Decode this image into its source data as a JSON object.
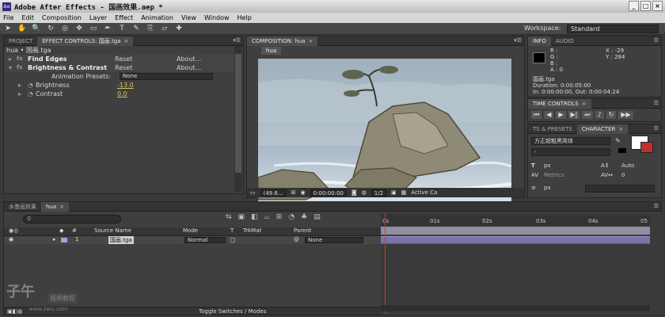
{
  "window": {
    "app_icon": "Ae",
    "title": "Adobe After Effects - 国画效果.aep *",
    "buttons": [
      "_",
      "□",
      "×"
    ]
  },
  "menu": [
    "File",
    "Edit",
    "Composition",
    "Layer",
    "Effect",
    "Animation",
    "View",
    "Window",
    "Help"
  ],
  "toolbar": {
    "tools": [
      "hand-pointer-icon",
      "hand-icon",
      "zoom-icon",
      "rotate-icon",
      "orbit-icon",
      "pan-icon",
      "rect-mask-icon",
      "pen-icon",
      "text-icon",
      "brush-icon",
      "clone-icon",
      "eraser-icon",
      "puppet-icon"
    ],
    "tool_glyphs": [
      "➤",
      "✋",
      "🔍",
      "↻",
      "◎",
      "✥",
      "▭",
      "✒",
      "T",
      "✎",
      "⎘",
      "▱",
      "✚"
    ],
    "workspace_label": "Workspace:",
    "workspace_value": "Standard"
  },
  "project_panel": {
    "tabs": [
      "PROJECT",
      "EFFECT CONTROLS: 国画.tga"
    ],
    "header": "hua • 国画.tga",
    "effects": [
      {
        "name": "Find Edges",
        "reset": "Reset",
        "about": "About..."
      },
      {
        "name": "Brightness & Contrast",
        "reset": "Reset",
        "about": "About..."
      }
    ],
    "animation_presets_label": "Animation Presets:",
    "animation_presets_value": "None",
    "params": [
      {
        "name": "Brightness",
        "value": "-13.0"
      },
      {
        "name": "Contrast",
        "value": "0.0"
      }
    ]
  },
  "composition": {
    "tab": "COMPOSITION: hua",
    "subtab": "hua",
    "zoom": "(49.6...",
    "timecode": "0:00:00:00",
    "resolution": "1/2",
    "camera": "Active Ca"
  },
  "info": {
    "tabs": [
      "INFO",
      "AUDIO"
    ],
    "r": "R :",
    "g": "G :",
    "b": "B :",
    "a": "A : 0",
    "x": "X : -29",
    "y": "Y : 284",
    "file": "国画.tga",
    "duration": "Duration: 0:00:05:00",
    "inout": "In: 0:00:00:00, Out: 0:00:04:24"
  },
  "time_controls": {
    "tab": "TIME CONTROLS"
  },
  "character": {
    "tabs": [
      "TS & PRESETS",
      "CHARACTER"
    ],
    "font": "方正超粗黑简体",
    "style": "-",
    "size": "px",
    "leading": "Auto",
    "tracking_label": "Metrics",
    "tracking_value": "0",
    "indent": "px"
  },
  "timeline": {
    "tabs": [
      "水墨画效果",
      "hua"
    ],
    "search_placeholder": "",
    "columns": {
      "source_name": "Source Name",
      "mode": "Mode",
      "t": "T",
      "trkmat": "TrkMat",
      "parent": "Parent"
    },
    "layer": {
      "index": "1",
      "name": "国画.tga",
      "mode": "Normal",
      "parent": "None"
    },
    "ruler": [
      "0s",
      "01s",
      "02s",
      "03s",
      "04s",
      "05"
    ],
    "footer": "Toggle Switches / Modes"
  },
  "watermark": {
    "logo": "子午",
    "text": "视频教程",
    "url": "www.zwu.com"
  }
}
